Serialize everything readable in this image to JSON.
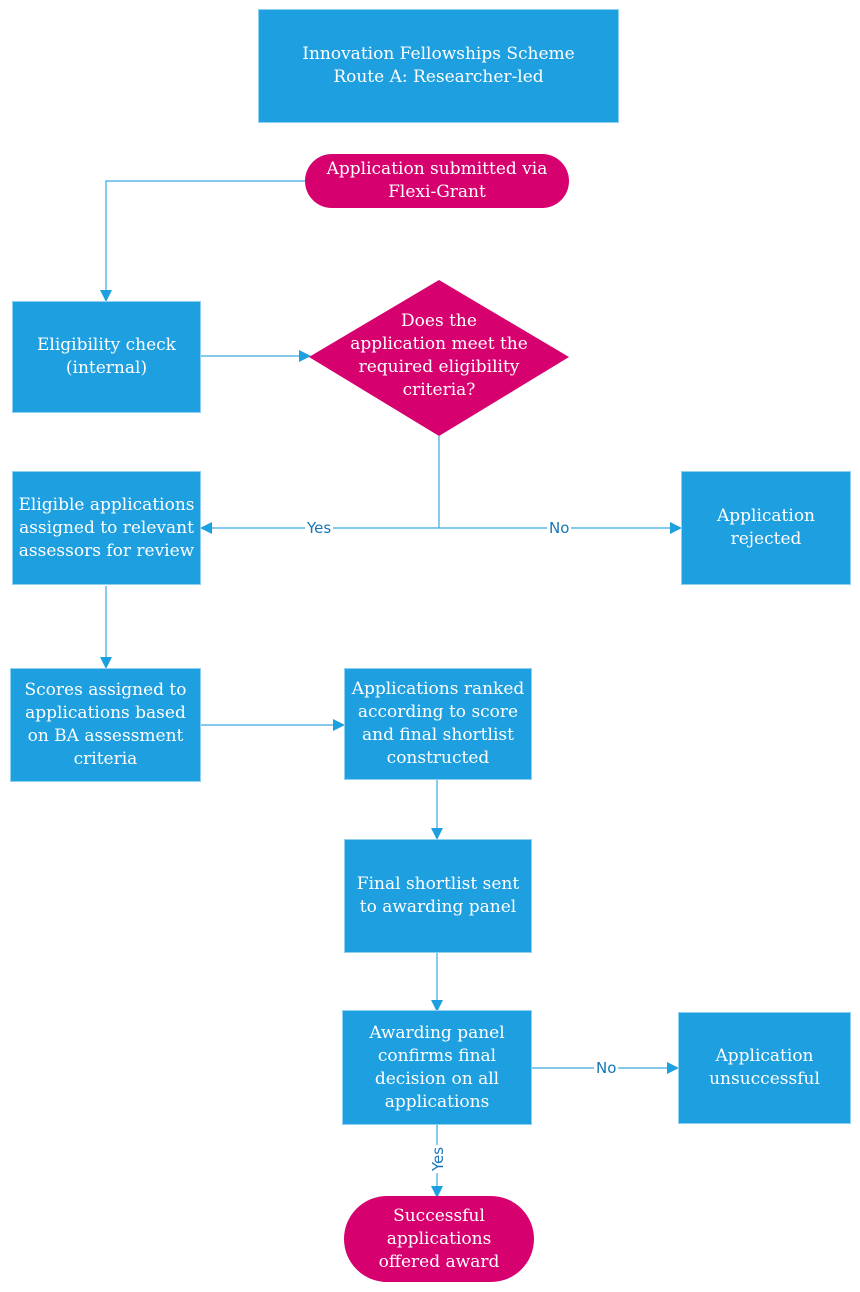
{
  "diagram": {
    "title_node": {
      "line1": "Innovation Fellowships Scheme",
      "line2": "Route A: Researcher-led"
    },
    "nodes": {
      "submitted": "Application submitted via\nFlexi-Grant",
      "eligibility_check": "Eligibility check\n(internal)",
      "eligibility_decision": "Does the\napplication meet the\nrequired eligibility\ncriteria?",
      "assigned": "Eligible applications\nassigned to relevant\nassessors for review",
      "rejected": "Application\nrejected",
      "scores": "Scores assigned to\napplications based\non BA assessment\ncriteria",
      "ranked": "Applications ranked\naccording to score\nand final shortlist\nconstructed",
      "shortlist_sent": "Final  shortlist sent\nto awarding panel",
      "panel_confirms": "Awarding panel\nconfirms final\ndecision on all\napplications",
      "unsuccessful": "Application\nunsuccessful",
      "successful": "Successful\napplications\noffered award"
    },
    "edge_labels": {
      "eligible_yes": "Yes",
      "eligible_no": "No",
      "panel_no": "No",
      "panel_yes": "Yes"
    },
    "colors": {
      "process": "#1e9fe0",
      "terminal": "#d6006f",
      "decision": "#d6006f",
      "connector": "#3aa8e0",
      "label_text": "#1676b8"
    }
  }
}
